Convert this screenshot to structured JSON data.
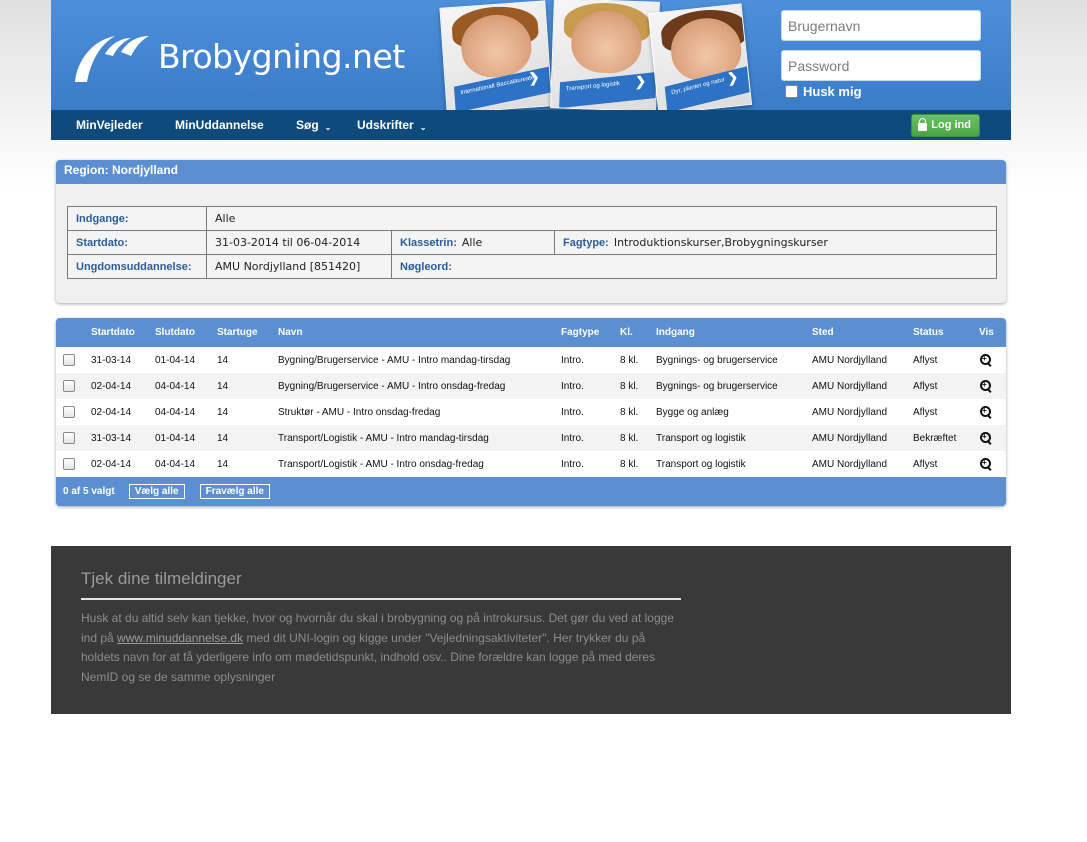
{
  "header": {
    "logo_text": "Brobygning.net",
    "photos": [
      {
        "band_text": "Internationalt Baccalaureate"
      },
      {
        "band_text": "Transport og logistik"
      },
      {
        "band_text": "Dyr, planter og natur"
      }
    ],
    "login": {
      "username_placeholder": "Brugernavn",
      "password_placeholder": "Password",
      "remember_label": "Husk mig"
    }
  },
  "nav": {
    "items": [
      {
        "label": "MinVejleder"
      },
      {
        "label": "MinUddannelse"
      },
      {
        "label": "Søg"
      },
      {
        "label": "Udskrifter"
      }
    ],
    "login_button": "Log ind"
  },
  "region": {
    "title": "Region: Nordjylland",
    "fields": {
      "indgange_label": "Indgange:",
      "indgange_value": "Alle",
      "startdato_label": "Startdato:",
      "startdato_value": "31-03-2014 til 06-04-2014",
      "klassetrin_label": "Klassetrin:",
      "klassetrin_value": "Alle",
      "fagtype_label": "Fagtype:",
      "fagtype_value": "Introduktionskurser,Brobygningskurser",
      "ungdom_label": "Ungdomsuddannelse:",
      "ungdom_value": "AMU Nordjylland [851420]",
      "noegleord_label": "Nøgleord:",
      "noegleord_value": ""
    }
  },
  "results": {
    "columns": [
      "Startdato",
      "Slutdato",
      "Startuge",
      "Navn",
      "Fagtype",
      "Kl.",
      "Indgang",
      "Sted",
      "Status",
      "Vis"
    ],
    "rows": [
      {
        "start": "31-03-14",
        "slut": "01-04-14",
        "uge": "14",
        "navn": "Bygning/Brugerservice - AMU - Intro mandag-tirsdag",
        "fagtype": "Intro.",
        "kl": "8 kl.",
        "indgang": "Bygnings- og brugerservice",
        "sted": "AMU Nordjylland",
        "status": "Aflyst"
      },
      {
        "start": "02-04-14",
        "slut": "04-04-14",
        "uge": "14",
        "navn": "Bygning/Brugerservice - AMU - Intro onsdag-fredag",
        "fagtype": "Intro.",
        "kl": "8 kl.",
        "indgang": "Bygnings- og brugerservice",
        "sted": "AMU Nordjylland",
        "status": "Aflyst"
      },
      {
        "start": "02-04-14",
        "slut": "04-04-14",
        "uge": "14",
        "navn": "Struktør - AMU - Intro onsdag-fredag",
        "fagtype": "Intro.",
        "kl": "8 kl.",
        "indgang": "Bygge og anlæg",
        "sted": "AMU Nordjylland",
        "status": "Aflyst"
      },
      {
        "start": "31-03-14",
        "slut": "01-04-14",
        "uge": "14",
        "navn": "Transport/Logistik - AMU - Intro mandag-tirsdag",
        "fagtype": "Intro.",
        "kl": "8 kl.",
        "indgang": "Transport og logistik",
        "sted": "AMU Nordjylland",
        "status": "Bekræftet"
      },
      {
        "start": "02-04-14",
        "slut": "04-04-14",
        "uge": "14",
        "navn": "Transport/Logistik - AMU - Intro onsdag-fredag",
        "fagtype": "Intro.",
        "kl": "8 kl.",
        "indgang": "Transport og logistik",
        "sted": "AMU Nordjylland",
        "status": "Aflyst"
      }
    ],
    "selected_count": "0 af 5 valgt",
    "select_all": "Vælg alle",
    "deselect_all": "Fravælg alle"
  },
  "infobox": {
    "title": "Tjek dine tilmeldinger",
    "text_before_link": "Husk at du altid selv kan tjekke, hvor og hvornår du skal i brobygning og på introkursus. Det gør du ved at logge ind på ",
    "link_text": "www.minuddannelse.dk",
    "text_after_link": " med dit UNI-login og kigge under \"Vejledningsaktiviteter\". Her trykker du på holdets navn for at få yderligere info om mødetidspunkt, indhold osv.. Dine forældre kan logge på med deres NemID og se de samme oplysninger"
  },
  "colors": {
    "header_blue": "#4d8fd9",
    "nav_dark_blue": "#0e4b7c",
    "panel_blue": "#5b8fd2",
    "login_green": "#4aa443",
    "label_blue": "#2b5d9b",
    "info_dark": "#393939"
  },
  "icons": [
    "logo-mark-icon",
    "lock-icon",
    "chevron-down-icon",
    "magnifier-plus-icon"
  ]
}
